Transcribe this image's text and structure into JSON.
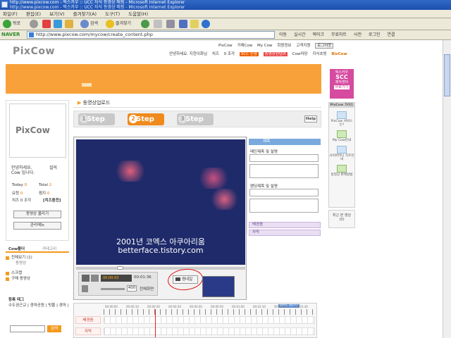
{
  "window": {
    "title_line1": "http://www.pixcow.com - 픽스카우 :: UCC 자식 동영상 매핑 - Microsoft Internet Explorer",
    "title_line2": "http://www.pixcow.com - 픽스카우 :: UCC 자식 동영상 매핑 - Microsoft Internet Explorer"
  },
  "menu": [
    "파일(F)",
    "편집(E)",
    "보기(V)",
    "즐겨찾기(A)",
    "도구(T)",
    "도움말(H)"
  ],
  "toolbar": {
    "back": "뒤로",
    "search": "검색",
    "favorites": "즐겨찾기"
  },
  "address": {
    "naver": "NAVER",
    "url": "http://www.pixcow.com/mycow/create_content.php",
    "go": "이동",
    "realtime": "실시간",
    "bookmark": "북마크",
    "free_music": "무료차트",
    "dictionary": "사전",
    "login": "로그인",
    "connect": "연결"
  },
  "site": {
    "logo": "PixCow",
    "topnav": [
      "PixCow",
      "거래Cow",
      "My Cow",
      "회원정보",
      "고객지원"
    ],
    "logout": "로그아웃",
    "greeting": "안녕하세요. 지한이화님",
    "cheese": "치즈",
    "cheese_unit": "0 조각",
    "tag_scc": "SCC 신청",
    "tag_video": "동영상컨텐츠",
    "cow_tour": "Cow마당",
    "ji": "지식초빙",
    "bizcow": "BizCow"
  },
  "ads": {
    "ad1_line1": "픽스카우",
    "ad1_big": "SCC",
    "ad1_line3": "제작센터",
    "ad1_btn": "바로가기",
    "ad2_hdr": "PixCow 가이드",
    "ad2_items": [
      "PixCow 서비스는?",
      "My Cow안내",
      "사이버머니 치즈안내",
      "동영상 판매방법"
    ],
    "ad3_line1": "최근 본 영상",
    "ad3_line2": "(0)"
  },
  "profile": {
    "logo": "PixCow",
    "greet": "안녕하세요.",
    "greet_r": "설의",
    "greet2": "Cow 입니다.",
    "today_label": "Today",
    "today": "0",
    "total_label": "Total",
    "total": "2",
    "yochung_label": "요청",
    "yochung": "0",
    "jjim_label": "찜지",
    "jjim": "0",
    "cheese_label": "치즈",
    "cheese": "0 조각",
    "charge": "[치즈충전]",
    "upload_btn": "동영상 올리기",
    "manage_btn": "관리메뉴"
  },
  "cowmenu": {
    "tab1": "Cow폴더",
    "tab2": "카테고리",
    "items": [
      "전체보기 (1)",
      "동영상",
      "스크랩",
      "구매 동영상"
    ]
  },
  "tags": {
    "title": "등록 태그",
    "list": "수도권근교 | 경마공원 | 빗물 | 경마 |",
    "search_btn": "검색"
  },
  "upload": {
    "header": "동영상업로드",
    "step1": "Step",
    "step2": "Step",
    "step3": "Step",
    "help": "Help"
  },
  "video": {
    "caption_line1": "2001년 코엑스 아쿠아리움",
    "caption_line2": "betterface.tistory.com",
    "time": "00:00:03",
    "duration": "00:01:36",
    "volume": "400",
    "fullscreen": "전체화면",
    "thumb_btn": "썸네일"
  },
  "form": {
    "tab": "제목",
    "label1": "메인제목 및 설명",
    "label2": "팬딩제목 및 설명",
    "tab_bg": "배경음",
    "tab_sub": "자막"
  },
  "timeline": {
    "row1": "배경음",
    "row2": "자막",
    "ticks": [
      "00:00:00",
      "00:00:10",
      "00:00:20",
      "00:00:30",
      "00:00:40",
      "00:00:50",
      "00:01:00",
      "00:01:10",
      "00:01:20",
      "00:01:30"
    ],
    "badge": "BRYE AUTO"
  }
}
